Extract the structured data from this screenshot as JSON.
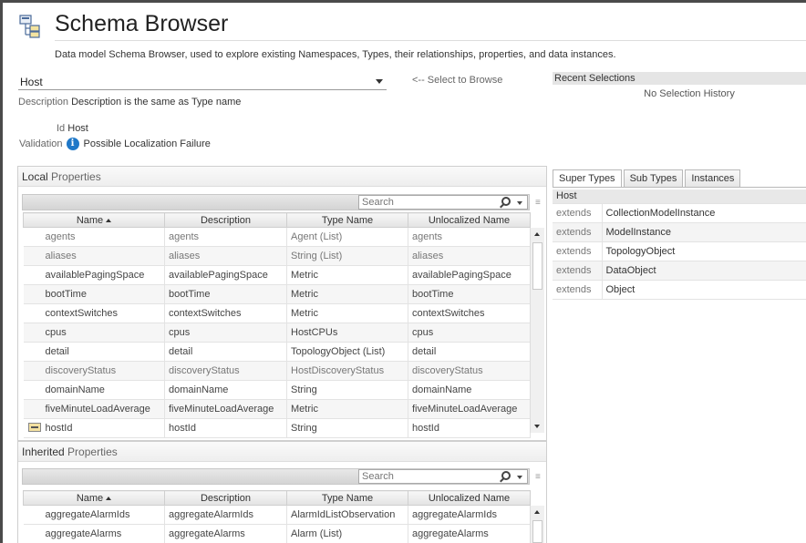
{
  "page": {
    "title": "Schema Browser",
    "subtitle": "Data model Schema Browser, used to explore existing Namespaces, Types, their relationships, properties, and data instances."
  },
  "type_select": {
    "value": "Host",
    "hint": "<-- Select to Browse"
  },
  "recent": {
    "header": "Recent Selections",
    "empty": "No Selection History"
  },
  "details": {
    "description_label": "Description",
    "description_value": "Description is the same as Type name",
    "id_label": "Id",
    "id_value": "Host",
    "validation_label": "Validation",
    "validation_value": "Possible Localization Failure"
  },
  "local_properties": {
    "title_prefix": "Local",
    "title_suffix": "Properties",
    "search_placeholder": "Search",
    "columns": [
      "Name",
      "Description",
      "Type Name",
      "Unlocalized Name"
    ],
    "rows": [
      [
        "agents",
        "agents",
        "Agent (List)",
        "agents"
      ],
      [
        "aliases",
        "aliases",
        "String (List)",
        "aliases"
      ],
      [
        "availablePagingSpace",
        "availablePagingSpace",
        "Metric",
        "availablePagingSpace"
      ],
      [
        "bootTime",
        "bootTime",
        "Metric",
        "bootTime"
      ],
      [
        "contextSwitches",
        "contextSwitches",
        "Metric",
        "contextSwitches"
      ],
      [
        "cpus",
        "cpus",
        "HostCPUs",
        "cpus"
      ],
      [
        "detail",
        "detail",
        "TopologyObject (List)",
        "detail"
      ],
      [
        "discoveryStatus",
        "discoveryStatus",
        "HostDiscoveryStatus",
        "discoveryStatus"
      ],
      [
        "domainName",
        "domainName",
        "String",
        "domainName"
      ],
      [
        "fiveMinuteLoadAverage",
        "fiveMinuteLoadAverage",
        "Metric",
        "fiveMinuteLoadAverage"
      ],
      [
        "hostId",
        "hostId",
        "String",
        "hostId"
      ]
    ]
  },
  "inherited_properties": {
    "title_prefix": "Inherited",
    "title_suffix": "Properties",
    "search_placeholder": "Search",
    "columns": [
      "Name",
      "Description",
      "Type Name",
      "Unlocalized Name"
    ],
    "rows": [
      [
        "aggregateAlarmIds",
        "aggregateAlarmIds",
        "AlarmIdListObservation",
        "aggregateAlarmIds"
      ],
      [
        "aggregateAlarms",
        "aggregateAlarms",
        "Alarm (List)",
        "aggregateAlarms"
      ]
    ]
  },
  "side_tabs": [
    "Super Types",
    "Sub Types",
    "Instances"
  ],
  "super_types": {
    "header": "Host",
    "rows": [
      [
        "extends",
        "CollectionModelInstance"
      ],
      [
        "extends",
        "ModelInstance"
      ],
      [
        "extends",
        "TopologyObject"
      ],
      [
        "extends",
        "DataObject"
      ],
      [
        "extends",
        "Object"
      ]
    ]
  }
}
